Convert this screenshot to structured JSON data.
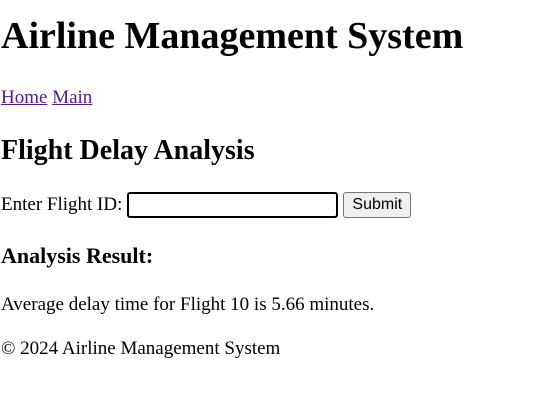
{
  "header": {
    "title": "Airline Management System"
  },
  "nav": {
    "links": [
      {
        "label": "Home"
      },
      {
        "label": "Main"
      }
    ]
  },
  "main": {
    "section_title": "Flight Delay Analysis",
    "form": {
      "label": "Enter Flight ID:",
      "input_value": "",
      "submit_label": "Submit"
    },
    "result": {
      "heading": "Analysis Result:",
      "text": "Average delay time for Flight 10 is 5.66 minutes."
    }
  },
  "footer": {
    "text": "© 2024 Airline Management System"
  },
  "colors": {
    "visited_link": "#551a8b",
    "text": "#000000",
    "background": "#ffffff"
  }
}
